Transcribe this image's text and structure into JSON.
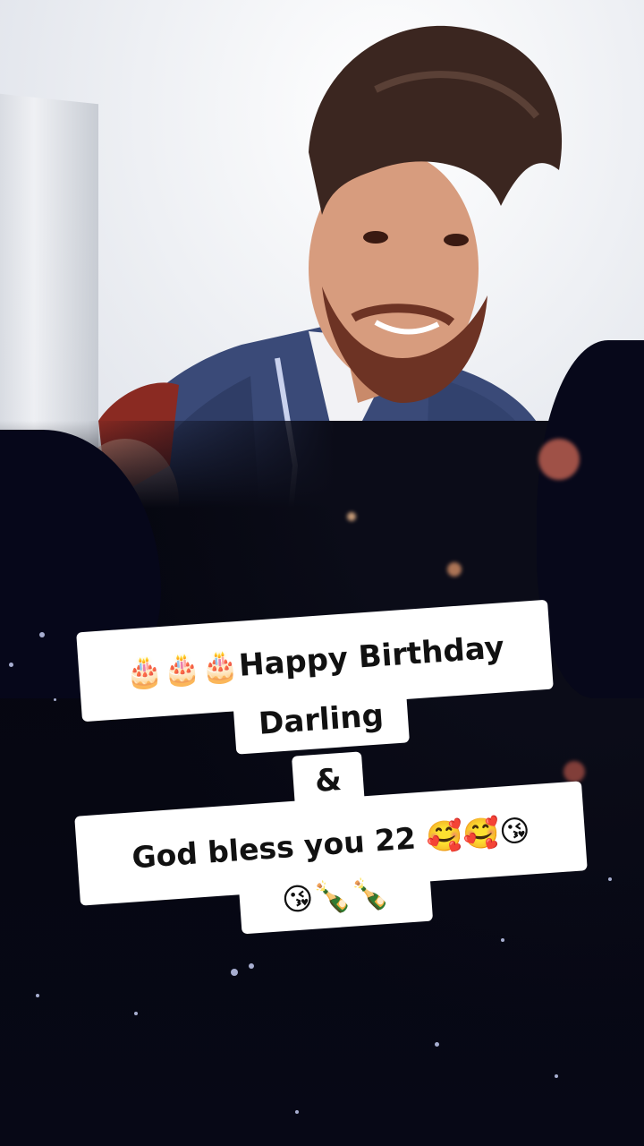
{
  "caption": {
    "line1": "🎂🎂🎂Happy Birthday",
    "line2": "Darling",
    "line3": "&",
    "line4": "God bless you 22 🥰🥰😘",
    "line5": "😘🍾🍾"
  }
}
